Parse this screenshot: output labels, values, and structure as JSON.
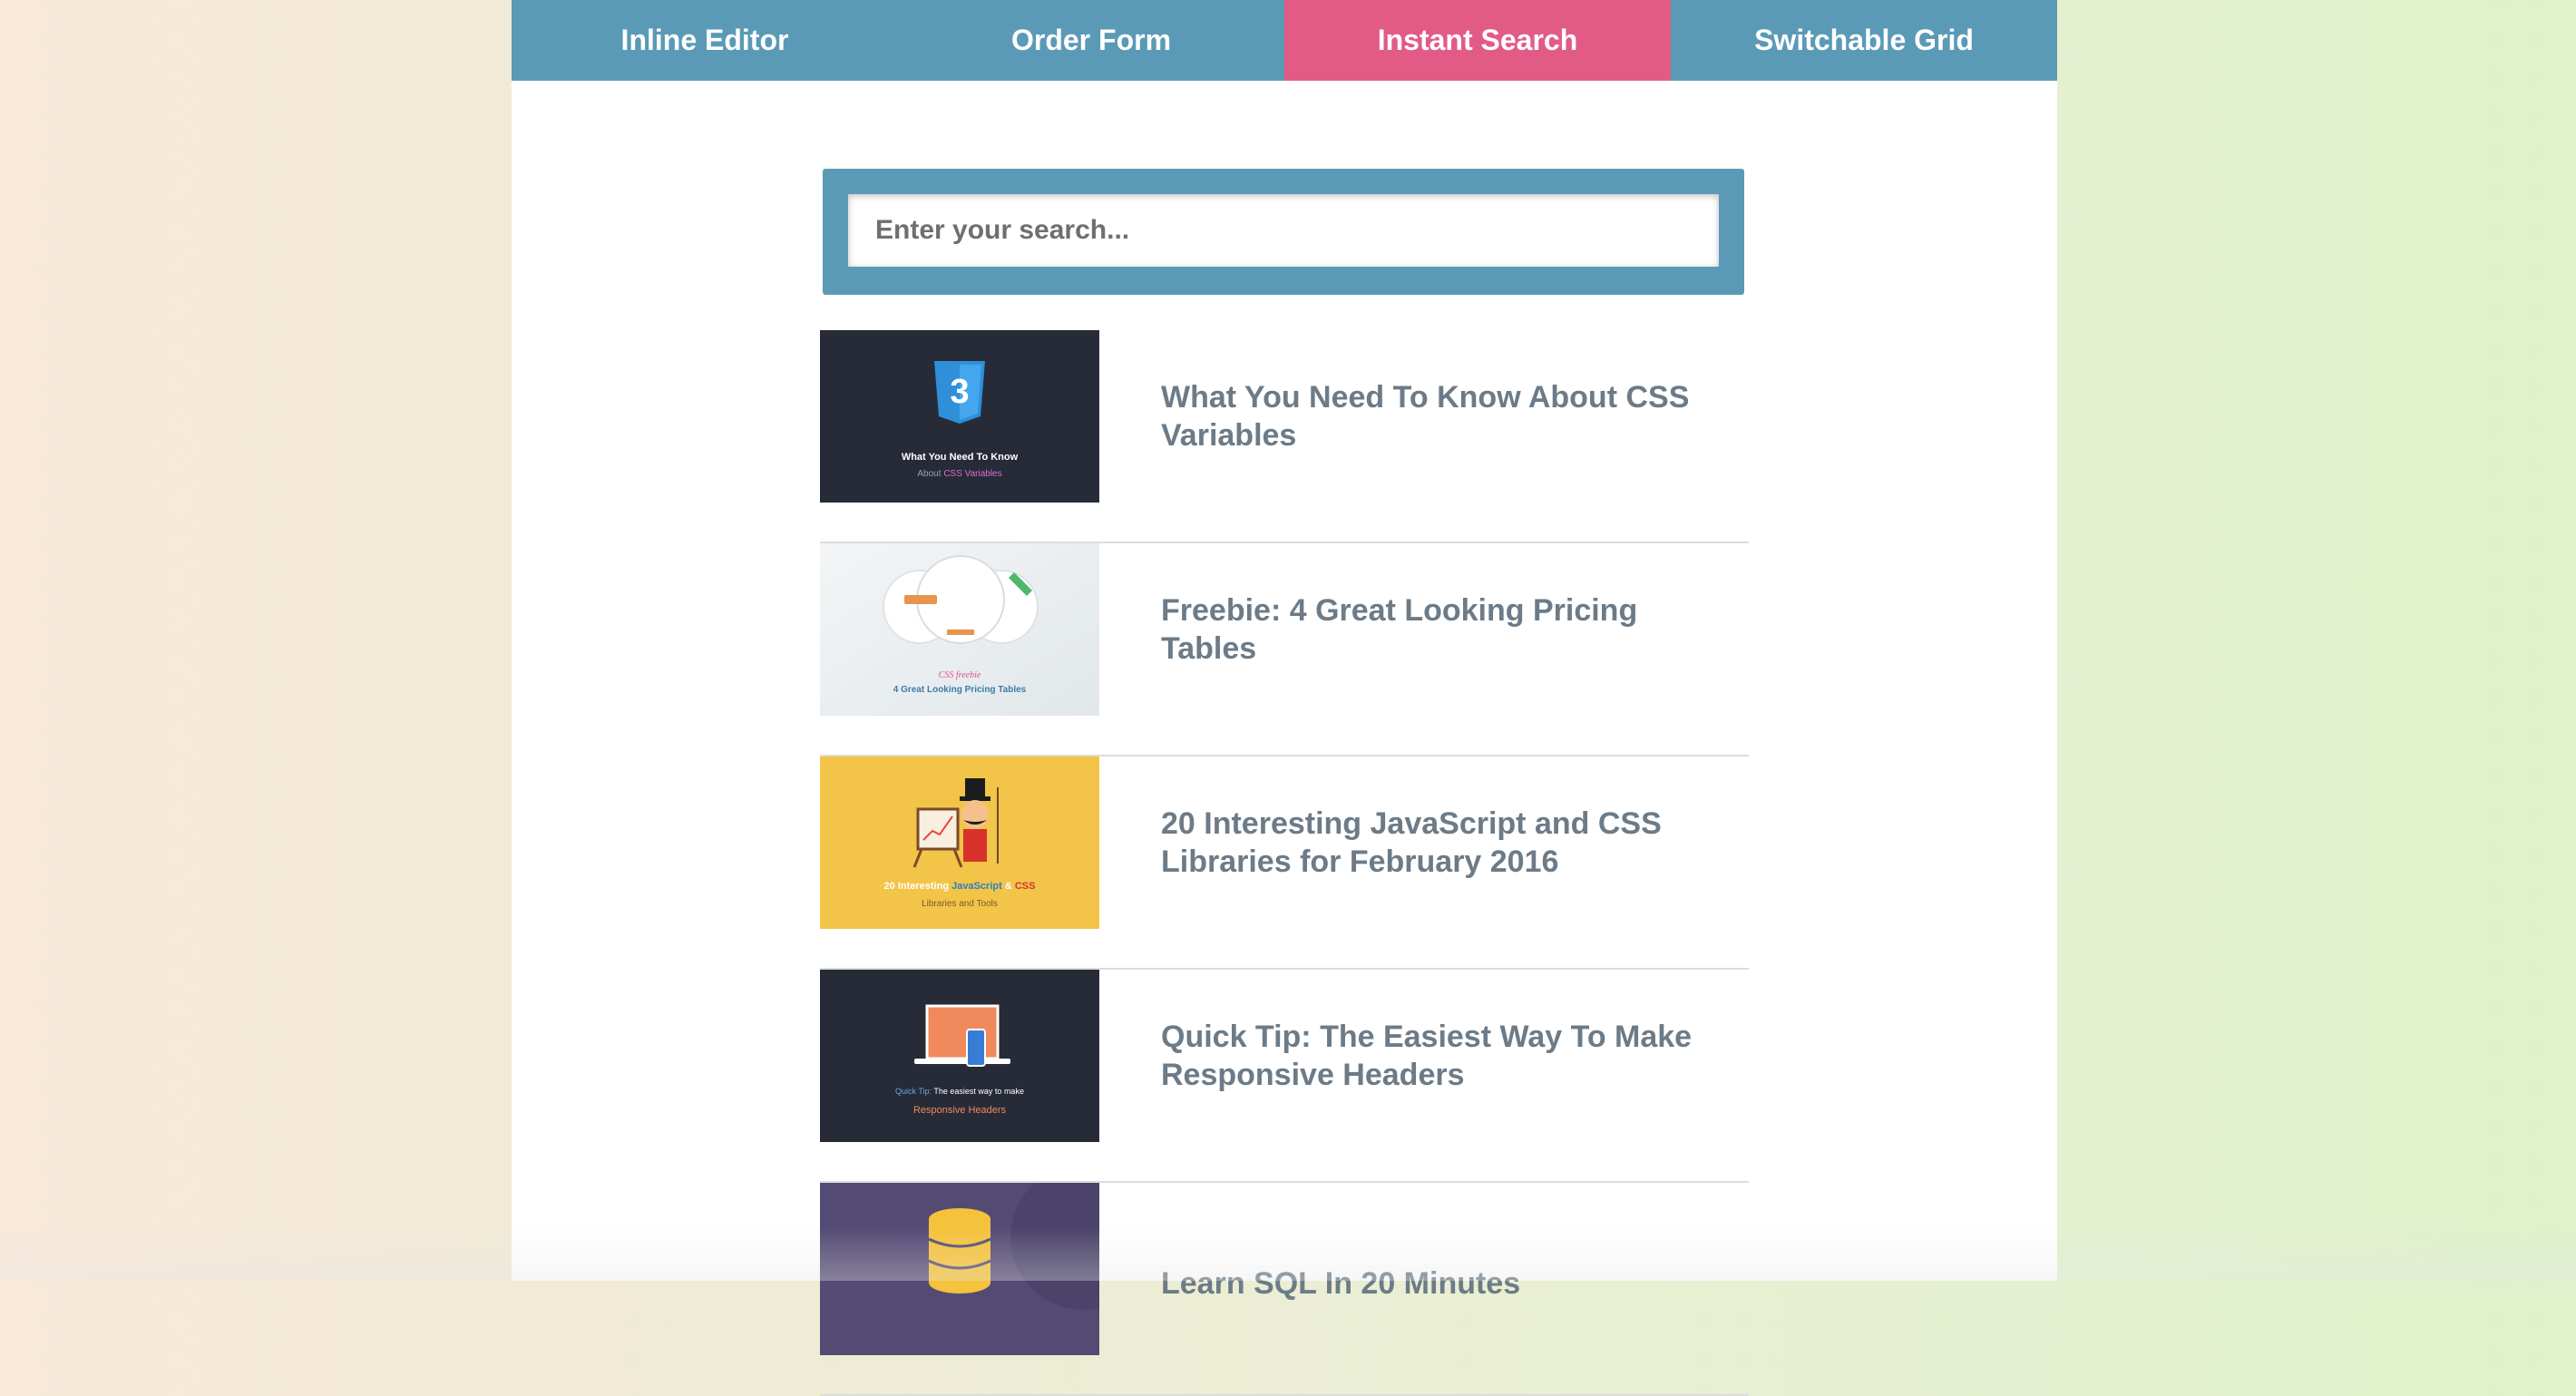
{
  "nav": {
    "tabs": [
      {
        "label": "Inline Editor",
        "active": false
      },
      {
        "label": "Order Form",
        "active": false
      },
      {
        "label": "Instant Search",
        "active": true
      },
      {
        "label": "Switchable Grid",
        "active": false
      }
    ]
  },
  "search": {
    "placeholder": "Enter your search...",
    "value": ""
  },
  "articles": [
    {
      "title": "What You Need To Know About CSS Variables",
      "thumb": {
        "line1": "What You Need To Know",
        "line2a": "About ",
        "line2b": "CSS Variables",
        "icon": "css3-shield-icon"
      }
    },
    {
      "title": "Freebie: 4 Great Looking Pricing Tables",
      "thumb": {
        "line1": "CSS freebie",
        "line2": "4 Great Looking Pricing Tables",
        "icon": "pricing-circles-icon"
      }
    },
    {
      "title": "20 Interesting JavaScript and CSS Libraries for February 2016",
      "thumb": {
        "w1": "20 Interesting ",
        "w2": "JavaScript",
        "w3": " & ",
        "w4": "CSS",
        "line2": "Libraries and Tools",
        "icon": "ringmaster-icon"
      }
    },
    {
      "title": "Quick Tip: The Easiest Way To Make Responsive Headers",
      "thumb": {
        "line1a": "Quick Tip:",
        "line1b": " The easiest way to make",
        "line2": "Responsive Headers",
        "icon": "laptop-phone-icon"
      }
    },
    {
      "title": "Learn SQL In 20 Minutes",
      "thumb": {
        "icon": "database-icon"
      }
    }
  ],
  "colors": {
    "nav_bg": "#5a9ab7",
    "nav_active": "#e25b86",
    "title_text": "#6c7b87"
  }
}
